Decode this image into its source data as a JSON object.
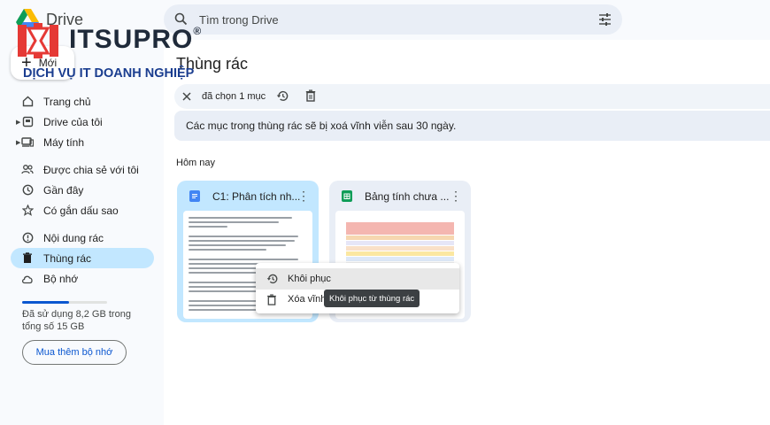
{
  "app": {
    "name": "Drive"
  },
  "watermark": {
    "title": "ITSUPRO",
    "reg": "®",
    "subtitle": "DỊCH VỤ IT DOANH NGHIỆP"
  },
  "search": {
    "placeholder": "Tìm trong Drive"
  },
  "new_button": {
    "label": "Mới"
  },
  "sidebar": {
    "items": [
      {
        "label": "Trang chủ",
        "icon": "home-icon"
      },
      {
        "label": "Drive của tôi",
        "icon": "drive-icon"
      },
      {
        "label": "Máy tính",
        "icon": "computer-icon"
      },
      {
        "label": "Được chia sẻ với tôi",
        "icon": "people-icon"
      },
      {
        "label": "Gần đây",
        "icon": "clock-icon"
      },
      {
        "label": "Có gắn dấu sao",
        "icon": "star-icon"
      },
      {
        "label": "Nội dung rác",
        "icon": "warning-icon"
      },
      {
        "label": "Thùng rác",
        "icon": "trash-icon",
        "active": true
      },
      {
        "label": "Bộ nhớ",
        "icon": "cloud-icon"
      }
    ],
    "storage": {
      "text": "Đã sử dụng 8,2 GB trong tổng số 15 GB",
      "used_fraction": 0.55
    },
    "buy_label": "Mua thêm bộ nhớ"
  },
  "main": {
    "title": "Thùng rác",
    "selection": {
      "count_label": "đã chọn 1 mục"
    },
    "notice": "Các mục trong thùng rác sẽ bị xoá vĩnh viễn sau 30 ngày.",
    "section": "Hôm nay",
    "files": [
      {
        "name": "C1: Phân tích nh...",
        "type": "doc",
        "selected": true,
        "icon_color": "#4285f4"
      },
      {
        "name": "Bảng tính chưa ...",
        "type": "sheet",
        "selected": false,
        "icon_color": "#0f9d58"
      }
    ]
  },
  "context_menu": {
    "items": [
      {
        "label": "Khôi phục",
        "icon": "restore-icon"
      },
      {
        "label": "Xóa vĩnh",
        "icon": "trash-icon"
      }
    ],
    "tooltip": "Khôi phục từ thùng rác"
  },
  "colors": {
    "accent": "#0b57d0",
    "active_nav": "#c2e7ff",
    "surface": "#f8fafd"
  }
}
